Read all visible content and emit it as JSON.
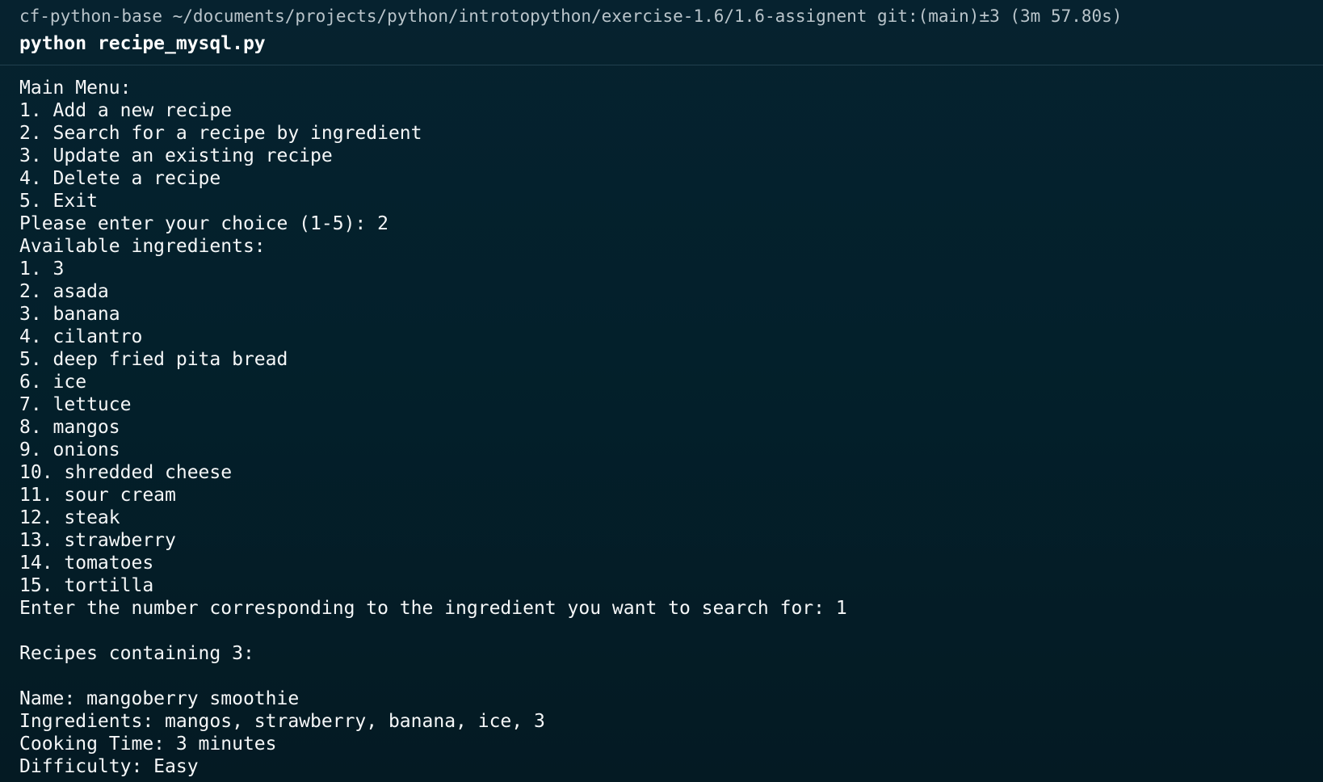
{
  "header": {
    "prompt": "cf-python-base ~/documents/projects/python/introtopython/exercise-1.6/1.6-assignent git:(main)±3 (3m 57.80s)",
    "command": "python recipe_mysql.py"
  },
  "output": [
    "Main Menu:",
    "1. Add a new recipe",
    "2. Search for a recipe by ingredient",
    "3. Update an existing recipe",
    "4. Delete a recipe",
    "5. Exit",
    "Please enter your choice (1-5): 2",
    "Available ingredients:",
    "1. 3",
    "2. asada",
    "3. banana",
    "4. cilantro",
    "5. deep fried pita bread",
    "6. ice",
    "7. lettuce",
    "8. mangos",
    "9. onions",
    "10. shredded cheese",
    "11. sour cream",
    "12. steak",
    "13. strawberry",
    "14. tomatoes",
    "15. tortilla",
    "Enter the number corresponding to the ingredient you want to search for: 1",
    "",
    "Recipes containing 3:",
    "",
    "Name: mangoberry smoothie",
    "Ingredients: mangos, strawberry, banana, ice, 3",
    "Cooking Time: 3 minutes",
    "Difficulty: Easy"
  ]
}
